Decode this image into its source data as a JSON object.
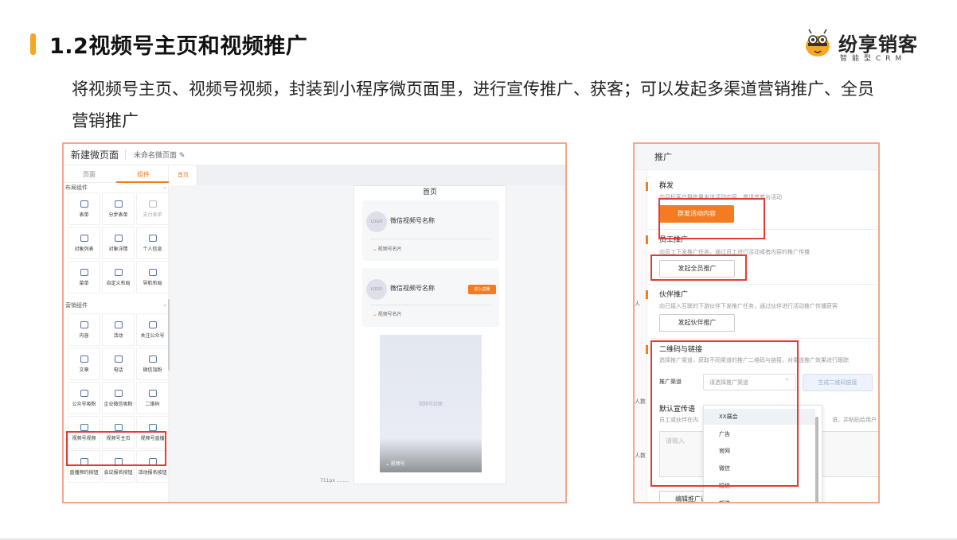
{
  "slide": {
    "title": "1.2视频号主页和视频推广",
    "description": "将视频号主页、视频号视频，封装到小程序微页面里，进行宣传推广、获客；可以发起多渠道营销推广、全员营销推广",
    "accent_color": "#f5a623",
    "highlight_color": "#e53935"
  },
  "logo": {
    "brand": "纷享销客",
    "sub": "智能型CRM",
    "icon": "bee-mascot-icon"
  },
  "editor": {
    "title": "新建微页面",
    "page_name": "未命名微页面",
    "tabs": [
      "页面",
      "组件"
    ],
    "active_tab": "组件",
    "page_tab": "首页",
    "layout_section": "布局组件",
    "layout_items": [
      "表单",
      "分步表单",
      "支付表单",
      "对象列表",
      "对象详情",
      "个人信息",
      "菜单",
      "自定义布局",
      "导航布局"
    ],
    "marketing_section": "营销组件",
    "marketing_items": [
      "内容",
      "活动",
      "关注公众号",
      "文章",
      "电话",
      "微信加粉",
      "公众号吸粉",
      "企业微信吸粉",
      "二维码",
      "视频号视频",
      "视频号主页",
      "视频号直播",
      "直播预约按钮",
      "会议报名按钮",
      "活动报名按钮"
    ],
    "preview": {
      "page_title": "首页",
      "logo_text": "LOGO",
      "account_name": "微信视频号名称",
      "account_card": "视频号名片",
      "live_button": "进入直播",
      "cover_text": "视频号封面",
      "cover_badge": "视频号",
      "width_label": "711px ........"
    }
  },
  "promo": {
    "header": "推广",
    "gutter_labels": [
      "人",
      "人数",
      "人数"
    ],
    "mass": {
      "title": "群发",
      "desc": "向目标客户群批量发送活动内容，邀请其参与活动",
      "button": "群发活动内容"
    },
    "staff": {
      "title": "员工推广",
      "desc": "向员工下发推广任务，通过员工进行活动或者内容的推广传播",
      "button": "发起全员推广"
    },
    "partner": {
      "title": "伙伴推广",
      "desc": "向已接入互联的下游伙伴下发推广任务，通过伙伴进行活动推广传播获客",
      "button": "发起伙伴推广"
    },
    "qr": {
      "title": "二维码与链接",
      "desc": "选择推广渠道，获取不同渠道的推广二维码与链接，对渠道推广效果进行跟踪",
      "channel_label": "推广渠道",
      "channel_placeholder": "请选择推广渠道",
      "generate_button": "生成二维码链接",
      "default_label": "默认宣传语",
      "default_desc_left": "员工或伙伴在内",
      "default_desc_right": "语，并粘贴给用户",
      "input_placeholder": "请输入",
      "edit_button": "编辑推广语"
    },
    "channel_options": [
      "XX展会",
      "广告",
      "官网",
      "微信",
      "短信",
      "邮件"
    ],
    "hovered_option": "XX展会"
  }
}
